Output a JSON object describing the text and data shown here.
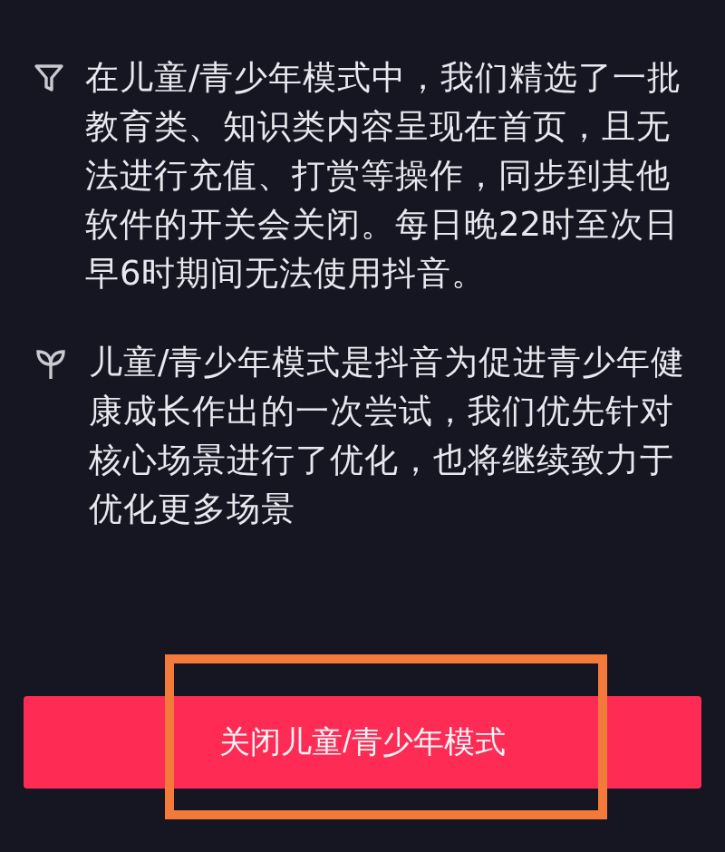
{
  "notes": [
    {
      "kind": "filter",
      "text": "在儿童/青少年模式中，我们精选了一批教育类、知识类内容呈现在首页，且无法进行充值、打赏等操作，同步到其他软件的开关会关闭。每日晚22时至次日早6时期间无法使用抖音。"
    },
    {
      "kind": "sprout",
      "text": "儿童/青少年模式是抖音为促进青少年健康成长作出的一次尝试，我们优先针对核心场景进行了优化，也将继续致力于优化更多场景"
    }
  ],
  "primary_button": {
    "label": "关闭儿童/青少年模式"
  }
}
